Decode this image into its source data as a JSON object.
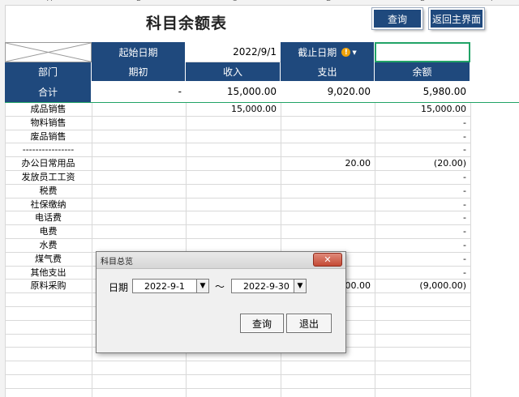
{
  "column_headers": [
    "A",
    "B",
    "C",
    "D",
    "E",
    "F"
  ],
  "title": "科目余额表",
  "buttons": {
    "query": "查询",
    "back_main": "返回主界面"
  },
  "criteria": {
    "start_label": "起始日期",
    "start_value": "2022/9/1",
    "end_label": "截止日期",
    "end_value": ""
  },
  "headers": [
    "部门",
    "期初",
    "收入",
    "支出",
    "余额"
  ],
  "total": {
    "label": "合计",
    "opening": "-",
    "income": "15,000.00",
    "expense": "9,020.00",
    "balance": "5,980.00"
  },
  "rows": [
    {
      "label": "成品销售",
      "income": "15,000.00",
      "expense": "",
      "balance": "15,000.00"
    },
    {
      "label": "物料销售",
      "income": "",
      "expense": "",
      "balance": "-"
    },
    {
      "label": "废品销售",
      "income": "",
      "expense": "",
      "balance": "-"
    },
    {
      "label": "----------------",
      "income": "",
      "expense": "",
      "balance": "-"
    },
    {
      "label": "办公日常用品",
      "income": "",
      "expense": "20.00",
      "balance": "(20.00)"
    },
    {
      "label": "发放员工工资",
      "income": "",
      "expense": "",
      "balance": "-"
    },
    {
      "label": "税费",
      "income": "",
      "expense": "",
      "balance": "-"
    },
    {
      "label": "社保缴纳",
      "income": "",
      "expense": "",
      "balance": "-"
    },
    {
      "label": "电话费",
      "income": "",
      "expense": "",
      "balance": "-"
    },
    {
      "label": "电费",
      "income": "",
      "expense": "",
      "balance": "-"
    },
    {
      "label": "水费",
      "income": "",
      "expense": "",
      "balance": "-"
    },
    {
      "label": "煤气费",
      "income": "",
      "expense": "",
      "balance": "-"
    },
    {
      "label": "其他支出",
      "income": "",
      "expense": "",
      "balance": "-"
    },
    {
      "label": "原料采购",
      "income": "",
      "expense": "9,000.00",
      "balance": "(9,000.00)"
    }
  ],
  "dialog": {
    "title": "科目总览",
    "close": "✕",
    "date_label": "日期",
    "from": "2022-9-1",
    "tilde": "～",
    "to": "2022-9-30",
    "query": "查询",
    "exit": "退出"
  },
  "icons": {
    "warning": "warning-icon",
    "dropdown": "dropdown-arrow-icon"
  },
  "colors": {
    "header_bg": "#1f497d",
    "selection": "#21a366"
  }
}
